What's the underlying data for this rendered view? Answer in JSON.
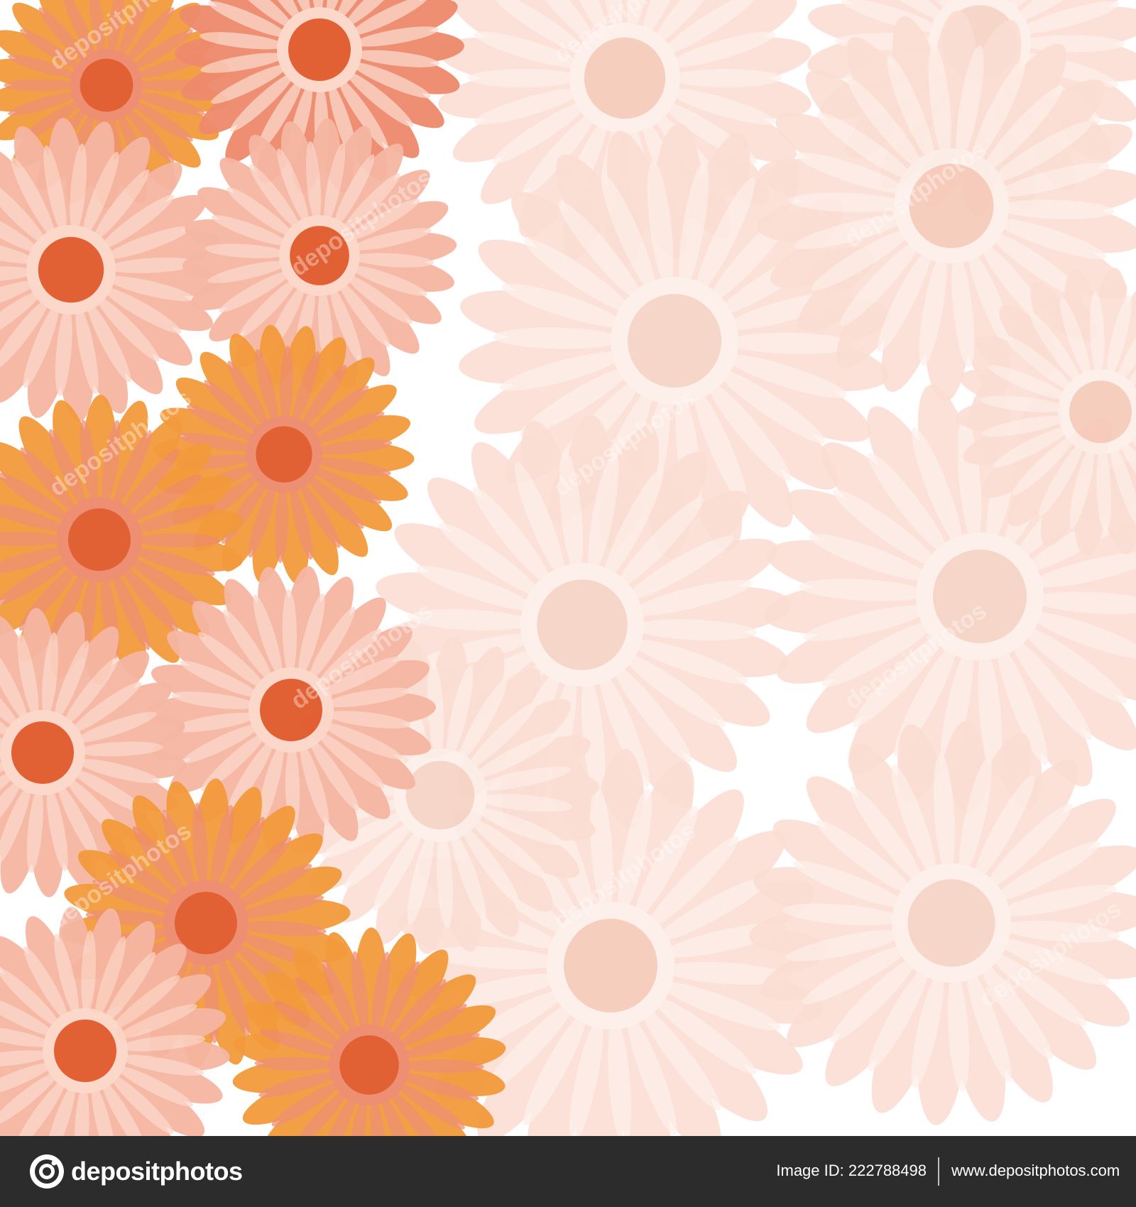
{
  "artwork": {
    "palette": {
      "bright_orange": "#f39a3c",
      "coral": "#ee8a6c",
      "peach": "#f5b6a2",
      "pale_peach": "#fbded3",
      "center_dark": "#e0592b",
      "background": "#ffffff"
    }
  },
  "watermark_text": "depositphotos",
  "footer": {
    "logo_text": "depositphotos",
    "image_id_label": "Image ID:",
    "image_id_value": "222788498",
    "site_url": "www.depositphotos.com",
    "background": "#2d2c2c"
  }
}
